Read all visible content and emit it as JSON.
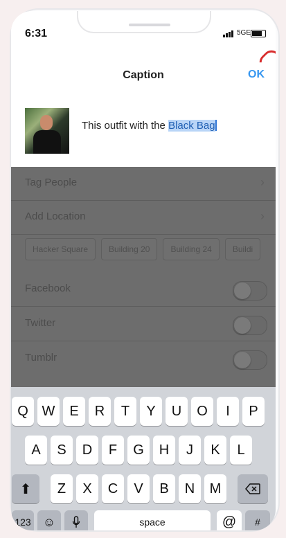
{
  "status": {
    "time": "6:31",
    "network": "5GE"
  },
  "nav": {
    "title": "Caption",
    "ok": "OK"
  },
  "compose": {
    "caption_prefix": "This outfit with the ",
    "caption_selected": "Black Bag"
  },
  "options": {
    "tag_people": "Tag People",
    "add_location": "Add Location",
    "location_suggestions": [
      "Hacker Square",
      "Building 20",
      "Building 24",
      "Buildi"
    ],
    "share": [
      {
        "label": "Facebook",
        "on": false
      },
      {
        "label": "Twitter",
        "on": false
      },
      {
        "label": "Tumblr",
        "on": false
      }
    ]
  },
  "keyboard": {
    "row1": [
      "Q",
      "W",
      "E",
      "R",
      "T",
      "Y",
      "U",
      "O",
      "I",
      "P"
    ],
    "row2": [
      "A",
      "S",
      "D",
      "F",
      "G",
      "H",
      "J",
      "K",
      "L"
    ],
    "row3": [
      "Z",
      "X",
      "C",
      "V",
      "B",
      "N",
      "M"
    ],
    "numbers_key": "123",
    "space_key": "space",
    "at_key": "@",
    "hash_key": "#",
    "icons": {
      "shift": "shift-icon",
      "backspace": "backspace-icon",
      "emoji": "emoji-icon",
      "mic": "microphone-icon"
    }
  },
  "colors": {
    "accent": "#3897f0",
    "selection": "#b9d5f7",
    "record": "#d82d2d"
  }
}
